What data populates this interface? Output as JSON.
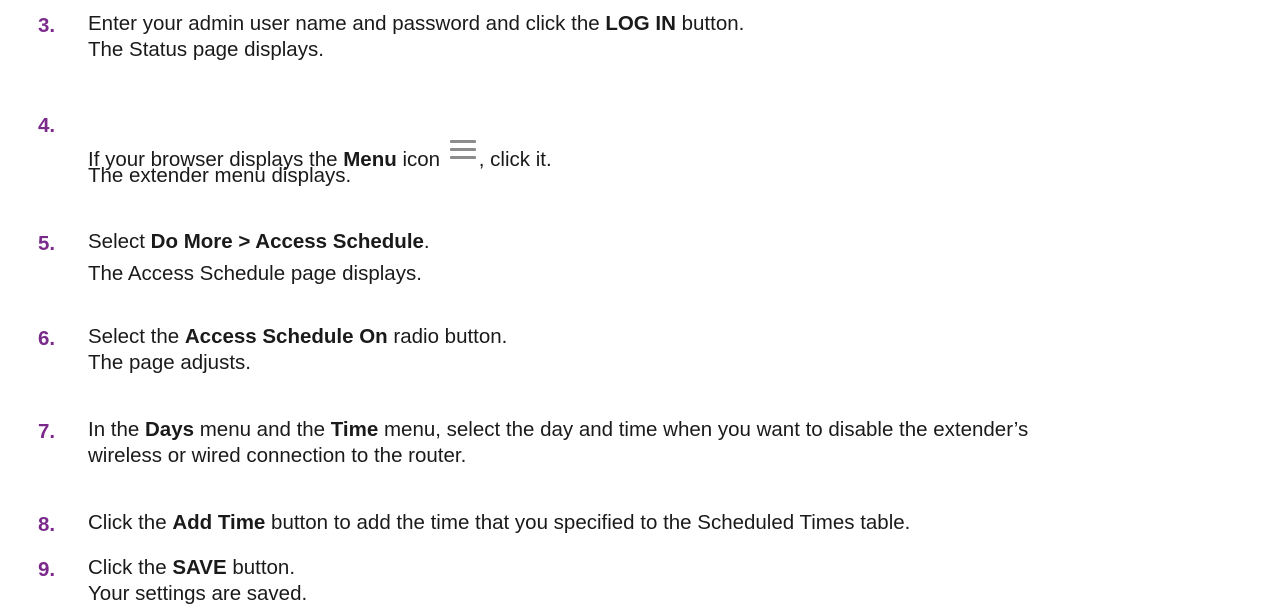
{
  "steps": [
    {
      "number": "3.",
      "line1": {
        "pre": "Enter your admin user name and password and click the ",
        "bold": "LOG IN",
        "post": " button."
      },
      "line2": "The Status page displays."
    },
    {
      "number": "4.",
      "line1": {
        "pre": "If your browser displays the ",
        "bold": "Menu",
        "mid": " icon ",
        "post": ", click it."
      },
      "icon": "menu-hamburger-icon",
      "line2": "The extender menu displays."
    },
    {
      "number": "5.",
      "line1": {
        "pre": "Select ",
        "bold": "Do More > Access Schedule",
        "post": "."
      },
      "line2": "The Access Schedule page displays."
    },
    {
      "number": "6.",
      "line1": {
        "pre": "Select the ",
        "bold": "Access Schedule On",
        "post": " radio button."
      },
      "line2": "The page adjusts."
    },
    {
      "number": "7.",
      "line1": {
        "pre": "In the ",
        "bold": "Days",
        "mid": " menu and the ",
        "bold2": "Time",
        "post": " menu, select the day and time when you want to disable the extender’s"
      },
      "line2": "wireless or wired connection to the router."
    },
    {
      "number": "8.",
      "line1": {
        "pre": "Click the ",
        "bold": "Add Time",
        "post": " button to add the time that you specified to the Scheduled Times table."
      }
    },
    {
      "number": "9.",
      "line1": {
        "pre": "Click the ",
        "bold": "SAVE",
        "post": " button."
      },
      "line2": "Your settings are saved."
    }
  ],
  "colors": {
    "step_number": "#7b2a8c",
    "body_text": "#1a1a1a",
    "icon_gray": "#8c8c8c"
  }
}
